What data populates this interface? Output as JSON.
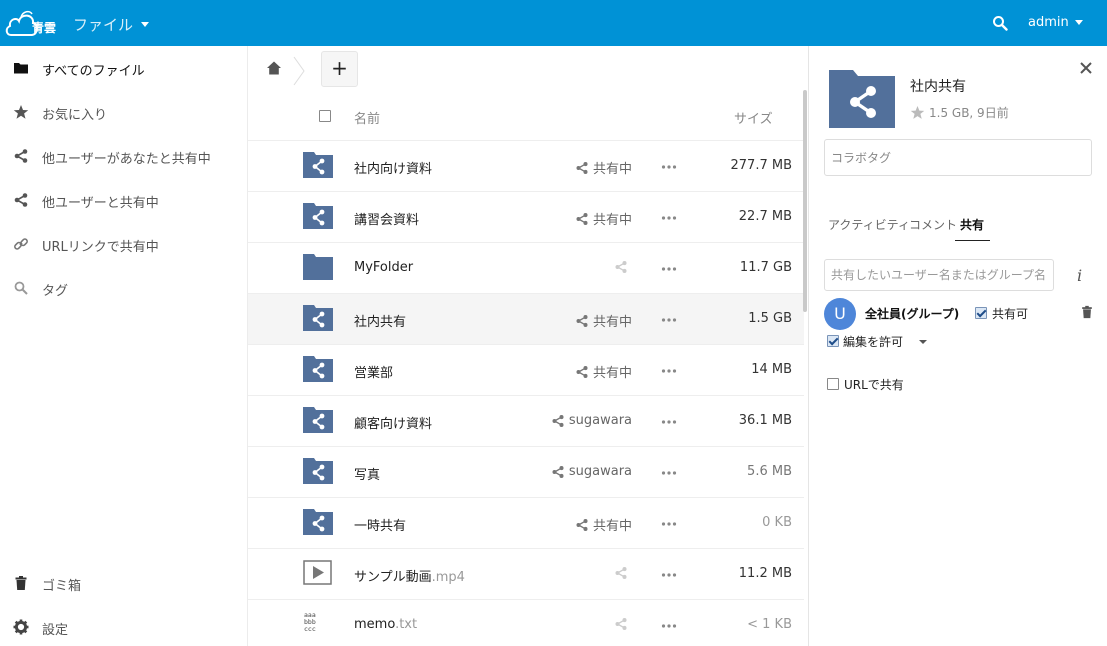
{
  "header": {
    "logo_text": "青雲",
    "app_label": "ファイル",
    "user_label": "admin",
    "icons": {
      "logo": "cloud-logo-icon",
      "search": "search-icon",
      "app_caret": "chevron-down-icon",
      "user_caret": "chevron-down-icon"
    },
    "background_color": "#0092d6"
  },
  "sidebar": {
    "top_items": [
      {
        "label": "すべてのファイル",
        "icon": "folder-icon",
        "active": true
      },
      {
        "label": "お気に入り",
        "icon": "star-icon"
      },
      {
        "label": "他ユーザーがあなたと共有中",
        "icon": "share-icon"
      },
      {
        "label": "他ユーザーと共有中",
        "icon": "share-icon"
      },
      {
        "label": "URLリンクで共有中",
        "icon": "link-icon"
      },
      {
        "label": "タグ",
        "icon": "tag-search-icon"
      }
    ],
    "bottom_items": [
      {
        "label": "ゴミ箱",
        "icon": "trash-icon"
      },
      {
        "label": "設定",
        "icon": "gear-icon"
      }
    ]
  },
  "controls": {
    "new_button_label": "+",
    "home_icon": "home-icon"
  },
  "filelist": {
    "columns": {
      "name": "名前",
      "size": "サイズ"
    },
    "rows": [
      {
        "name": "社内向け資料",
        "ext": "",
        "type": "shared-folder",
        "share": "共有中",
        "size": "277.7 MB"
      },
      {
        "name": "講習会資料",
        "ext": "",
        "type": "shared-folder",
        "share": "共有中",
        "size": "22.7 MB"
      },
      {
        "name": "MyFolder",
        "ext": "",
        "type": "folder",
        "share": "",
        "size": "11.7 GB"
      },
      {
        "name": "社内共有",
        "ext": "",
        "type": "shared-folder",
        "share": "共有中",
        "size": "1.5 GB",
        "selected": true
      },
      {
        "name": "営業部",
        "ext": "",
        "type": "shared-folder",
        "share": "共有中",
        "size": "14 MB"
      },
      {
        "name": "顧客向け資料",
        "ext": "",
        "type": "shared-folder",
        "share": "sugawara",
        "size": "36.1 MB"
      },
      {
        "name": "写真",
        "ext": "",
        "type": "shared-folder",
        "share": "sugawara",
        "size": "5.6 MB"
      },
      {
        "name": "一時共有",
        "ext": "",
        "type": "shared-folder",
        "share": "共有中",
        "size": "0 KB"
      },
      {
        "name": "サンプル動画",
        "ext": ".mp4",
        "type": "video",
        "share": "",
        "size": "11.2 MB"
      },
      {
        "name": "memo",
        "ext": ".txt",
        "type": "text",
        "share": "",
        "size": "< 1 KB"
      }
    ],
    "size_colors": [
      "#333333",
      "#333333",
      "#333333",
      "#333333",
      "#333333",
      "#333333",
      "#777777",
      "#999999",
      "#333333",
      "#999999"
    ],
    "folder_color": "#52709b"
  },
  "details": {
    "title": "社内共有",
    "meta": "1.5 GB, 9日前",
    "tags_placeholder": "コラボタグ",
    "tabs": [
      "アクティビティ",
      "コメント",
      "共有"
    ],
    "active_tab": 2,
    "share_input_placeholder": "共有したいユーザー名またはグループ名",
    "sharee": {
      "avatar_letter": "U",
      "name": "全社員(グループ)",
      "can_share_label": "共有可",
      "can_share": true,
      "can_edit_label": "編集を許可",
      "can_edit": true
    },
    "url_share_label": "URLで共有",
    "url_share": false,
    "avatar_color": "#4e86d9"
  }
}
